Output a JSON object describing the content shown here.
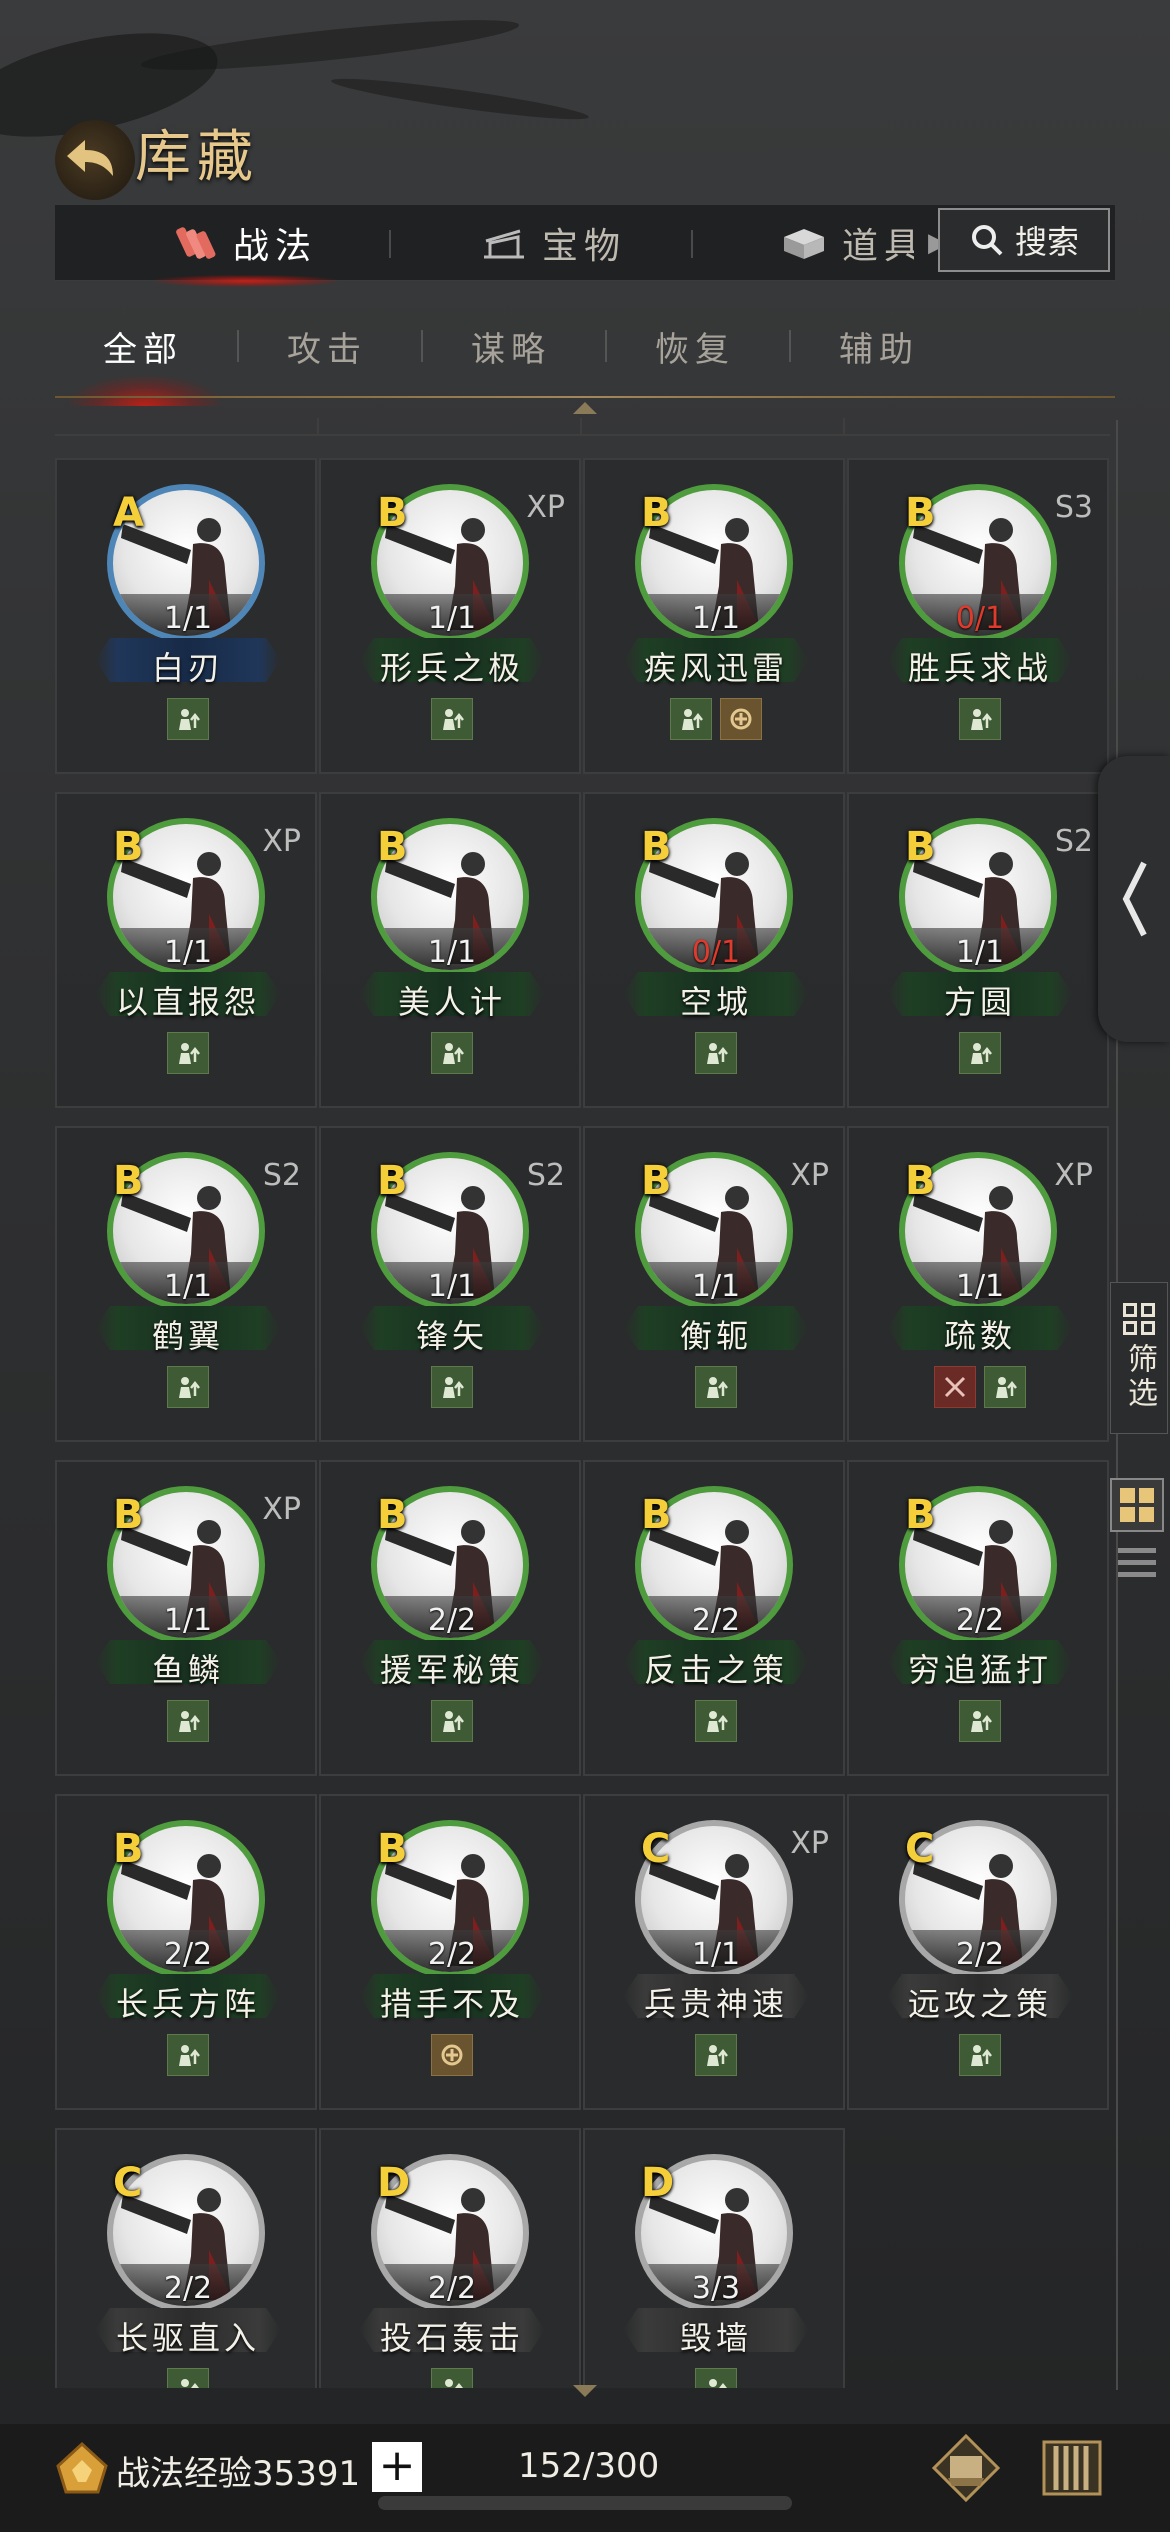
{
  "header": {
    "title": "库藏"
  },
  "top_tabs": [
    {
      "label": "战法",
      "active": true,
      "icon": "scroll-bundle-icon"
    },
    {
      "label": "宝物",
      "active": false,
      "icon": "treasure-altar-icon"
    },
    {
      "label": "道具",
      "active": false,
      "icon": "item-box-icon"
    }
  ],
  "search": {
    "label": "搜索"
  },
  "sub_tabs": [
    {
      "label": "全部",
      "active": true
    },
    {
      "label": "攻击",
      "active": false
    },
    {
      "label": "谋略",
      "active": false
    },
    {
      "label": "恢复",
      "active": false
    },
    {
      "label": "辅助",
      "active": false
    }
  ],
  "cards": [
    [
      {
        "grade": "A",
        "tag": "",
        "count": "1/1",
        "name": "白刃",
        "ring": "blue",
        "count_red": false,
        "icons": [
          "green"
        ]
      },
      {
        "grade": "B",
        "tag": "XP",
        "count": "1/1",
        "name": "形兵之极",
        "ring": "green",
        "count_red": false,
        "icons": [
          "green"
        ]
      },
      {
        "grade": "B",
        "tag": "",
        "count": "1/1",
        "name": "疾风迅雷",
        "ring": "green",
        "count_red": false,
        "icons": [
          "green",
          "gold"
        ]
      },
      {
        "grade": "B",
        "tag": "S3",
        "count": "0/1",
        "name": "胜兵求战",
        "ring": "green",
        "count_red": true,
        "icons": [
          "green"
        ]
      }
    ],
    [
      {
        "grade": "B",
        "tag": "XP",
        "count": "1/1",
        "name": "以直报怨",
        "ring": "green",
        "count_red": false,
        "icons": [
          "green"
        ]
      },
      {
        "grade": "B",
        "tag": "",
        "count": "1/1",
        "name": "美人计",
        "ring": "green",
        "count_red": false,
        "icons": [
          "green"
        ]
      },
      {
        "grade": "B",
        "tag": "",
        "count": "0/1",
        "name": "空城",
        "ring": "green",
        "count_red": true,
        "icons": [
          "green"
        ]
      },
      {
        "grade": "B",
        "tag": "S2",
        "count": "1/1",
        "name": "方圆",
        "ring": "green",
        "count_red": false,
        "icons": [
          "green"
        ]
      }
    ],
    [
      {
        "grade": "B",
        "tag": "S2",
        "count": "1/1",
        "name": "鹤翼",
        "ring": "green",
        "count_red": false,
        "icons": [
          "green"
        ]
      },
      {
        "grade": "B",
        "tag": "S2",
        "count": "1/1",
        "name": "锋矢",
        "ring": "green",
        "count_red": false,
        "icons": [
          "green"
        ]
      },
      {
        "grade": "B",
        "tag": "XP",
        "count": "1/1",
        "name": "衡轭",
        "ring": "green",
        "count_red": false,
        "icons": [
          "green"
        ]
      },
      {
        "grade": "B",
        "tag": "XP",
        "count": "1/1",
        "name": "疏数",
        "ring": "green",
        "count_red": false,
        "icons": [
          "red",
          "green"
        ]
      }
    ],
    [
      {
        "grade": "B",
        "tag": "XP",
        "count": "1/1",
        "name": "鱼鳞",
        "ring": "green",
        "count_red": false,
        "icons": [
          "green"
        ]
      },
      {
        "grade": "B",
        "tag": "",
        "count": "2/2",
        "name": "援军秘策",
        "ring": "green",
        "count_red": false,
        "icons": [
          "green"
        ]
      },
      {
        "grade": "B",
        "tag": "",
        "count": "2/2",
        "name": "反击之策",
        "ring": "green",
        "count_red": false,
        "icons": [
          "green"
        ]
      },
      {
        "grade": "B",
        "tag": "",
        "count": "2/2",
        "name": "穷追猛打",
        "ring": "green",
        "count_red": false,
        "icons": [
          "green"
        ]
      }
    ],
    [
      {
        "grade": "B",
        "tag": "",
        "count": "2/2",
        "name": "长兵方阵",
        "ring": "green",
        "count_red": false,
        "icons": [
          "green"
        ]
      },
      {
        "grade": "B",
        "tag": "",
        "count": "2/2",
        "name": "措手不及",
        "ring": "green",
        "count_red": false,
        "icons": [
          "gold"
        ]
      },
      {
        "grade": "C",
        "tag": "XP",
        "count": "1/1",
        "name": "兵贵神速",
        "ring": "grey",
        "count_red": false,
        "icons": [
          "green"
        ]
      },
      {
        "grade": "C",
        "tag": "",
        "count": "2/2",
        "name": "远攻之策",
        "ring": "grey",
        "count_red": false,
        "icons": [
          "green"
        ]
      }
    ],
    [
      {
        "grade": "C",
        "tag": "",
        "count": "2/2",
        "name": "长驱直入",
        "ring": "grey",
        "count_red": false,
        "icons": [
          "green"
        ]
      },
      {
        "grade": "D",
        "tag": "",
        "count": "2/2",
        "name": "投石轰击",
        "ring": "grey",
        "count_red": false,
        "icons": [
          "green"
        ]
      },
      {
        "grade": "D",
        "tag": "",
        "count": "3/3",
        "name": "毁墙",
        "ring": "grey",
        "count_red": false,
        "icons": [
          "green"
        ]
      }
    ]
  ],
  "side": {
    "filter_label": "筛选"
  },
  "bottom": {
    "exp_label": "战法经验35391",
    "plus": "+",
    "capacity": "152/300"
  },
  "colors": {
    "grade": "#f5cf3a",
    "accent_red": "#c22018",
    "ring_green": "#4f9c3e",
    "ring_blue": "#4f86b8"
  }
}
